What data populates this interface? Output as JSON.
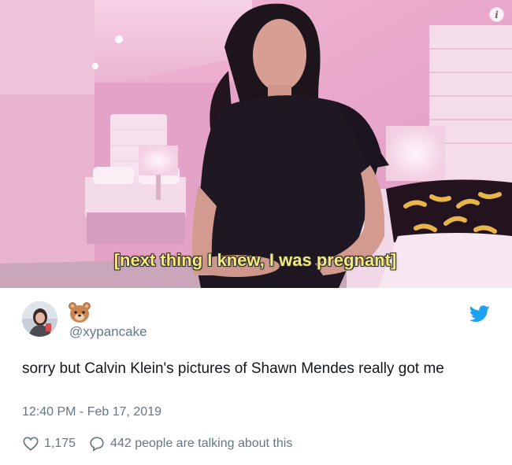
{
  "media": {
    "caption": "[next thing I knew, I was pregnant]",
    "info_icon_glyph": "i"
  },
  "tweet": {
    "handle": "@xypancake",
    "display_name_icon": "bear-emoji-icon",
    "text": "sorry but Calvin Klein's pictures of Shawn Mendes really got me",
    "timestamp": "12:40 PM - Feb 17, 2019",
    "likes": "1,175",
    "conversation": "442 people are talking about this"
  },
  "colors": {
    "twitter_blue": "#1da1f2",
    "secondary_text": "#657786",
    "caption_yellow": "#f4e97a",
    "room_pink": "#e8a7c9"
  }
}
